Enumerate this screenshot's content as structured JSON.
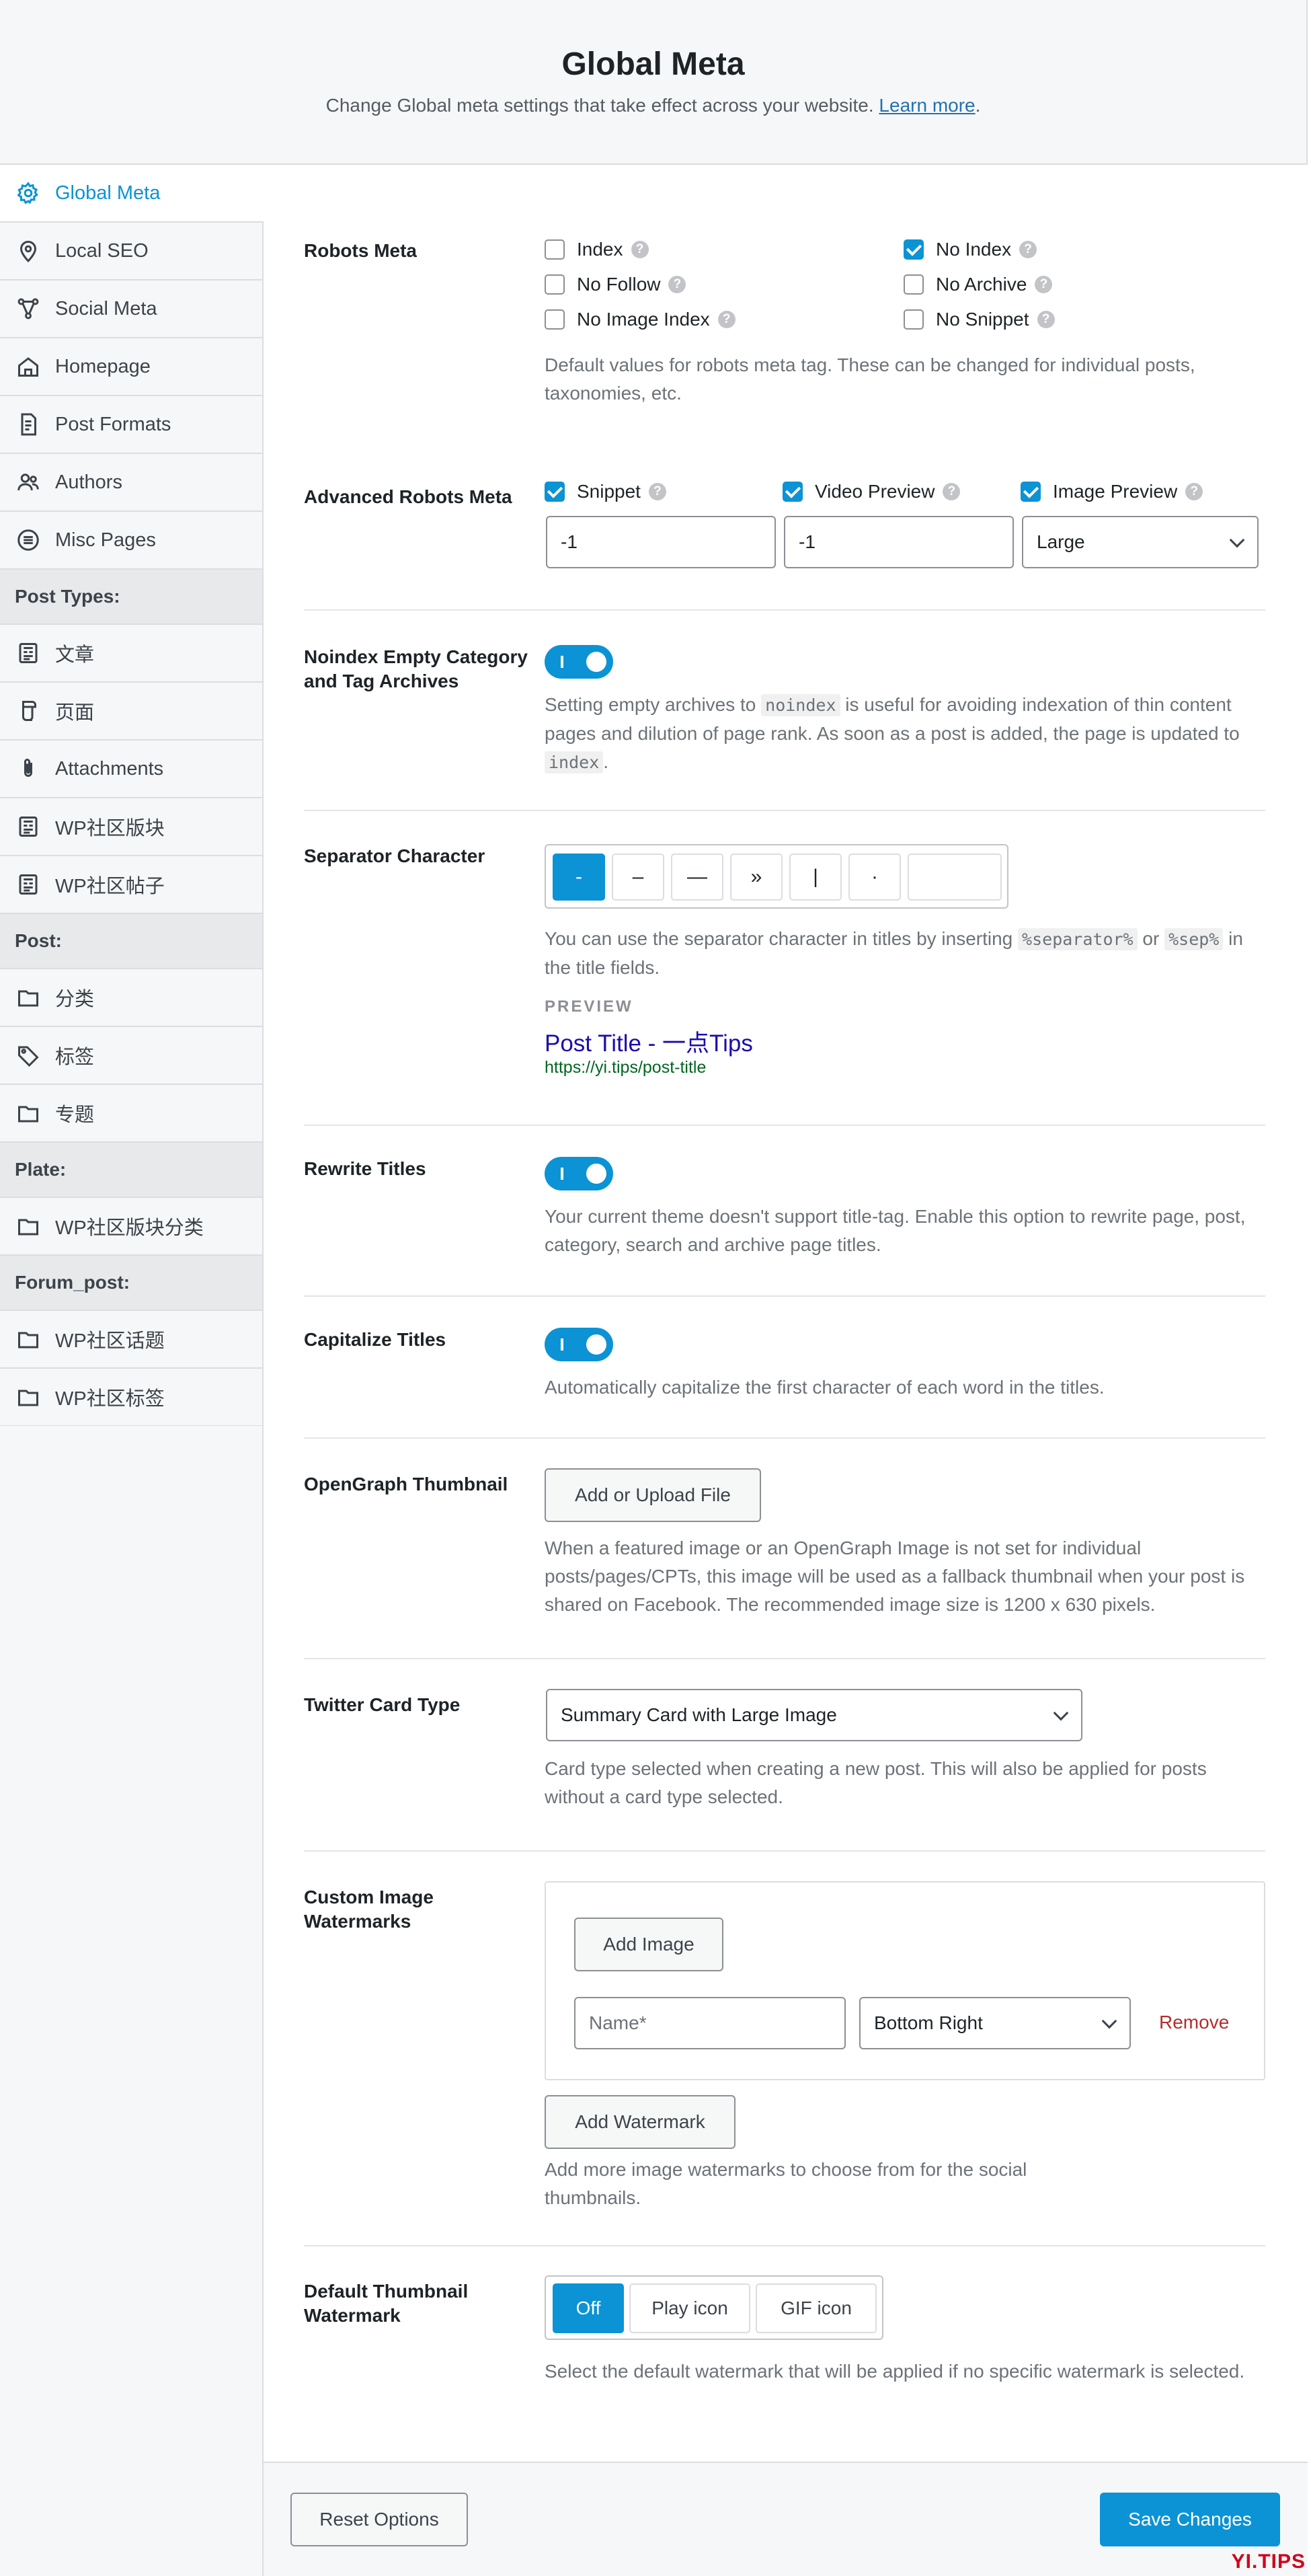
{
  "header": {
    "title": "Global Meta",
    "subtitle": "Change Global meta settings that take effect across your website.",
    "learn_more": "Learn more",
    "period": "."
  },
  "sidebar": {
    "items": [
      {
        "label": "Global Meta",
        "icon": "gear-icon",
        "active": true
      },
      {
        "label": "Local SEO",
        "icon": "map-pin-icon"
      },
      {
        "label": "Social Meta",
        "icon": "share-nodes-icon"
      },
      {
        "label": "Homepage",
        "icon": "home-icon"
      },
      {
        "label": "Post Formats",
        "icon": "document-icon"
      },
      {
        "label": "Authors",
        "icon": "users-icon"
      },
      {
        "label": "Misc Pages",
        "icon": "list-circle-icon"
      }
    ],
    "post_types_heading": "Post Types:",
    "post_types": [
      {
        "label": "文章",
        "icon": "article-icon"
      },
      {
        "label": "页面",
        "icon": "page-icon"
      },
      {
        "label": "Attachments",
        "icon": "paperclip-icon"
      },
      {
        "label": "WP社区版块",
        "icon": "article-icon"
      },
      {
        "label": "WP社区帖子",
        "icon": "article-icon"
      }
    ],
    "post_heading": "Post:",
    "post_items": [
      {
        "label": "分类",
        "icon": "folder-icon"
      },
      {
        "label": "标签",
        "icon": "tag-icon"
      },
      {
        "label": "专题",
        "icon": "folder-icon"
      }
    ],
    "plate_heading": "Plate:",
    "plate_items": [
      {
        "label": "WP社区版块分类",
        "icon": "folder-icon"
      }
    ],
    "forum_heading": "Forum_post:",
    "forum_items": [
      {
        "label": "WP社区话题",
        "icon": "folder-icon"
      },
      {
        "label": "WP社区标签",
        "icon": "folder-icon"
      }
    ]
  },
  "robots": {
    "label": "Robots Meta",
    "options": [
      {
        "label": "Index",
        "checked": false
      },
      {
        "label": "No Index",
        "checked": true
      },
      {
        "label": "No Follow",
        "checked": false
      },
      {
        "label": "No Archive",
        "checked": false
      },
      {
        "label": "No Image Index",
        "checked": false
      },
      {
        "label": "No Snippet",
        "checked": false
      }
    ],
    "desc": "Default values for robots meta tag. These can be changed for individual posts, taxonomies, etc."
  },
  "advanced": {
    "label": "Advanced Robots Meta",
    "snippet_label": "Snippet",
    "snippet_value": "-1",
    "video_label": "Video Preview",
    "video_value": "-1",
    "image_label": "Image Preview",
    "image_value": "Large"
  },
  "noindex": {
    "label": "Noindex Empty Category and Tag Archives",
    "desc_1": "Setting empty archives to",
    "code_1": "noindex",
    "desc_2": "is useful for avoiding indexation of thin content pages and dilution of page rank. As soon as a post is added, the page is updated to",
    "code_2": "index",
    "desc_3": "."
  },
  "separator": {
    "label": "Separator Character",
    "chars": [
      "-",
      "–",
      "—",
      "»",
      "|",
      "·"
    ],
    "desc_1": "You can use the separator character in titles by inserting",
    "code_1": "%separator%",
    "desc_2": "or",
    "code_2": "%sep%",
    "desc_3": "in the title fields.",
    "preview_label": "PREVIEW",
    "preview_title": "Post Title - 一点Tips",
    "preview_url": "https://yi.tips/post-title"
  },
  "rewrite": {
    "label": "Rewrite Titles",
    "desc": "Your current theme doesn't support title-tag. Enable this option to rewrite page, post, category, search and archive page titles."
  },
  "capitalize": {
    "label": "Capitalize Titles",
    "desc": "Automatically capitalize the first character of each word in the titles."
  },
  "opengraph": {
    "label": "OpenGraph Thumbnail",
    "button": "Add or Upload File",
    "desc": "When a featured image or an OpenGraph Image is not set for individual posts/pages/CPTs, this image will be used as a fallback thumbnail when your post is shared on Facebook. The recommended image size is 1200 x 630 pixels."
  },
  "twitter": {
    "label": "Twitter Card Type",
    "value": "Summary Card with Large Image",
    "desc": "Card type selected when creating a new post. This will also be applied for posts without a card type selected."
  },
  "watermarks": {
    "label": "Custom Image Watermarks",
    "add_image": "Add Image",
    "name_placeholder": "Name*",
    "position_value": "Bottom Right",
    "remove": "Remove",
    "add_watermark": "Add Watermark",
    "desc": "Add more image watermarks to choose from for the social thumbnails."
  },
  "default_wm": {
    "label": "Default Thumbnail Watermark",
    "options": [
      "Off",
      "Play icon",
      "GIF icon"
    ],
    "selected": "Off",
    "desc": "Select the default watermark that will be applied if no specific watermark is selected."
  },
  "footer": {
    "reset": "Reset Options",
    "save": "Save Changes"
  },
  "brand_logo": "YI.TIPS",
  "colors": {
    "accent": "#0b93d5",
    "link": "#2271b1",
    "danger": "#b32d2e"
  }
}
